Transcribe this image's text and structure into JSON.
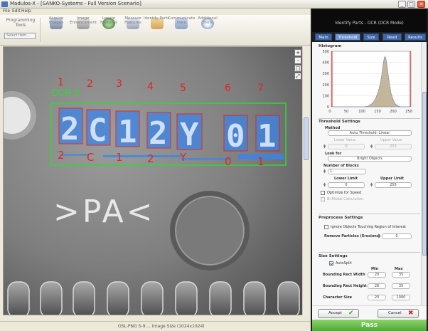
{
  "window": {
    "title": "Madulos-X - [SANKO-Systems - Full Version Scenario]",
    "controls": {
      "minimize": "_",
      "maximize": "□",
      "close": "✕"
    }
  },
  "menu": {
    "items": [
      "File",
      "Edit",
      "Help"
    ]
  },
  "toolbar": {
    "programming_label": "Programming Tools",
    "select_placeholder": "Select Item...",
    "buttons": [
      {
        "label": "Acquire Images",
        "icon": "camera-icon"
      },
      {
        "label": "Image Enhancement",
        "icon": "wand-icon"
      },
      {
        "label": "Locate Features",
        "icon": "target-icon"
      },
      {
        "label": "Measure Features",
        "icon": "ruler-icon"
      },
      {
        "label": "Identify Parts",
        "icon": "identify-icon"
      },
      {
        "label": "Communicate Data",
        "icon": "network-icon"
      },
      {
        "label": "Additional Tools",
        "icon": "gear-icon"
      }
    ]
  },
  "viewer": {
    "roi_label": "OCR 0",
    "upper_numbers": [
      "1",
      "2",
      "3",
      "4",
      "5",
      "6",
      "7"
    ],
    "lower_chars": [
      "2",
      "C",
      "1",
      "2",
      "Y",
      "0",
      "1"
    ],
    "recognized_text": [
      "2",
      "C",
      "1",
      "2",
      "Y",
      "0",
      "1"
    ],
    "part_marking": ">PA<",
    "zoom_tools": [
      "+",
      "-",
      "□",
      "⤢"
    ]
  },
  "statusbar": {
    "text": "OSL-PNG 5-9 ... Image Size (1024x1024)"
  },
  "panel": {
    "title": "Identify Parts - OCR (OCR Mode)",
    "tabs": [
      "Main",
      "Threshold",
      "Size",
      "Read",
      "Results"
    ],
    "active_tab": "Threshold",
    "histogram": {
      "header": "Histogram",
      "x_ticks": [
        "0",
        "50",
        "100",
        "150",
        "200",
        "250"
      ],
      "y_ticks": [
        "500",
        "400",
        "300",
        "200",
        "100",
        "0"
      ]
    },
    "threshold": {
      "header": "Threshold Settings",
      "method_label": "Method",
      "method_value": "Auto Threshold: Linear",
      "lower_label": "Lower Value",
      "lower_value": "0",
      "upper_label": "Upper Value",
      "upper_value": "255",
      "look_for_label": "Look for",
      "look_for_value": "Bright Objects",
      "blocks_label": "Number of Blocks",
      "blocks_value": "1",
      "lower_limit_label": "Lower Limit",
      "lower_limit_value": "0",
      "upper_limit_label": "Upper Limit",
      "upper_limit_value": "255",
      "optimize_label": "Optimize for Speed",
      "bi_modal_label": "Bi-Modal Calculation"
    },
    "preprocess": {
      "header": "Preprocess Settings",
      "ignore_label": "Ignore Objects Touching Region of Interest",
      "remove_label": "Remove Particles (Erosions)",
      "remove_value": "0"
    },
    "size": {
      "header": "Size Settings",
      "autosplit_label": "AutoSplit",
      "min_label": "Min",
      "max_label": "Max",
      "rows": [
        {
          "label": "Bounding Rect Width",
          "min": "20",
          "max": "35"
        },
        {
          "label": "Bounding Rect Height",
          "min": "26",
          "max": "35"
        },
        {
          "label": "Character Size",
          "min": "20",
          "max": "1000"
        }
      ]
    },
    "accept_label": "Accept",
    "cancel_label": "Cancel",
    "pass_label": "Pass"
  },
  "colors": {
    "roi_green": "#34D634",
    "char_box_red": "#E22020",
    "char_fill_blue": "#3C84E6",
    "annotation_red": "#E42323",
    "tab_blue": "#3F66A8",
    "pass_green": "#63BC48"
  }
}
